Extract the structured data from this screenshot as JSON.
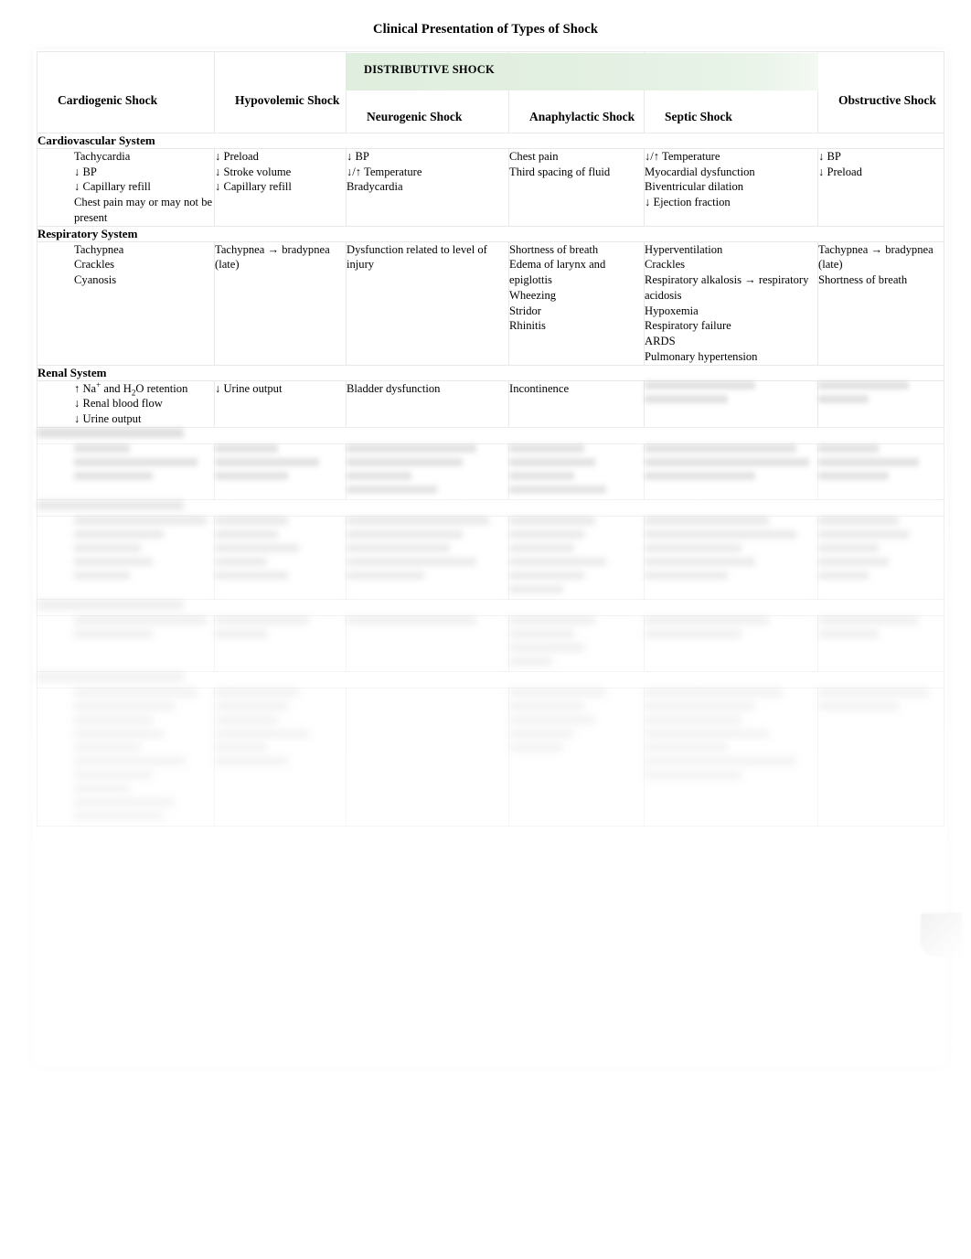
{
  "document": {
    "title": "Clinical Presentation of Types of Shock"
  },
  "table": {
    "group_header": {
      "label": "DISTRIBUTIVE SHOCK",
      "band_color": "#e3f0e2"
    },
    "columns": [
      {
        "key": "cardiogenic",
        "label": "Cardiogenic Shock"
      },
      {
        "key": "hypovolemic",
        "label": "Hypovolemic Shock"
      },
      {
        "key": "neurogenic",
        "label": "Neurogenic Shock"
      },
      {
        "key": "anaphylactic",
        "label": "Anaphylactic Shock"
      },
      {
        "key": "septic",
        "label": "Septic Shock"
      },
      {
        "key": "obstructive",
        "label": "Obstructive Shock"
      }
    ],
    "sections": [
      {
        "heading": "Cardiovascular System",
        "legible": true,
        "cells": {
          "cardiogenic": "Tachycardia\n↓ BP\n↓ Capillary refill\nChest pain may or may not be present",
          "hypovolemic": "↓ Preload\n↓ Stroke volume\n↓ Capillary refill",
          "neurogenic": "↓ BP\n↓/↑ Temperature\nBradycardia",
          "anaphylactic": "Chest pain\nThird spacing of fluid",
          "septic": "↓/↑ Temperature\nMyocardial dysfunction\nBiventricular dilation\n↓ Ejection fraction",
          "obstructive": "↓ BP\n↓ Preload"
        }
      },
      {
        "heading": "Respiratory System",
        "legible": true,
        "cells": {
          "cardiogenic": "Tachypnea\nCrackles\nCyanosis",
          "hypovolemic": "Tachypnea → bradypnea (late)",
          "neurogenic": "Dysfunction related to level of injury",
          "anaphylactic": "Shortness of breath\nEdema of larynx and epiglottis\nWheezing\nStridor\nRhinitis",
          "septic": "Hyperventilation\nCrackles\nRespiratory alkalosis → respiratory acidosis\nHypoxemia\nRespiratory failure\nARDS\nPulmonary hypertension",
          "obstructive": "Tachypnea → bradypnea (late)\nShortness of breath"
        }
      },
      {
        "heading": "Renal System",
        "legible": true,
        "cells": {
          "cardiogenic": "↑ Na+ and H2O retention\n↓ Renal blood flow\n↓ Urine output",
          "hypovolemic": "↓ Urine output",
          "neurogenic": "Bladder dysfunction",
          "anaphylactic": "Incontinence",
          "septic": "",
          "obstructive": ""
        },
        "cells_rich": {
          "cardiogenic": [
            "↑ Na<sup>+</sup> and H<sub>2</sub>O retention",
            "↓ Renal blood flow",
            "↓ Urine output"
          ]
        },
        "obscured_columns": [
          "septic",
          "obstructive"
        ]
      },
      {
        "heading": "",
        "legible": false,
        "blur_level": 1,
        "note": "Content below is blurred and faded in the source screenshot and is not legible."
      },
      {
        "heading": "",
        "legible": false,
        "blur_level": 2,
        "note": "Content below is blurred and faded in the source screenshot and is not legible."
      },
      {
        "heading": "",
        "legible": false,
        "blur_level": 3,
        "note": "Content below is blurred and faded in the source screenshot and is not legible."
      },
      {
        "heading": "",
        "legible": false,
        "blur_level": 4,
        "note": "Content below is blurred and faded in the source screenshot and is not legible."
      }
    ]
  }
}
